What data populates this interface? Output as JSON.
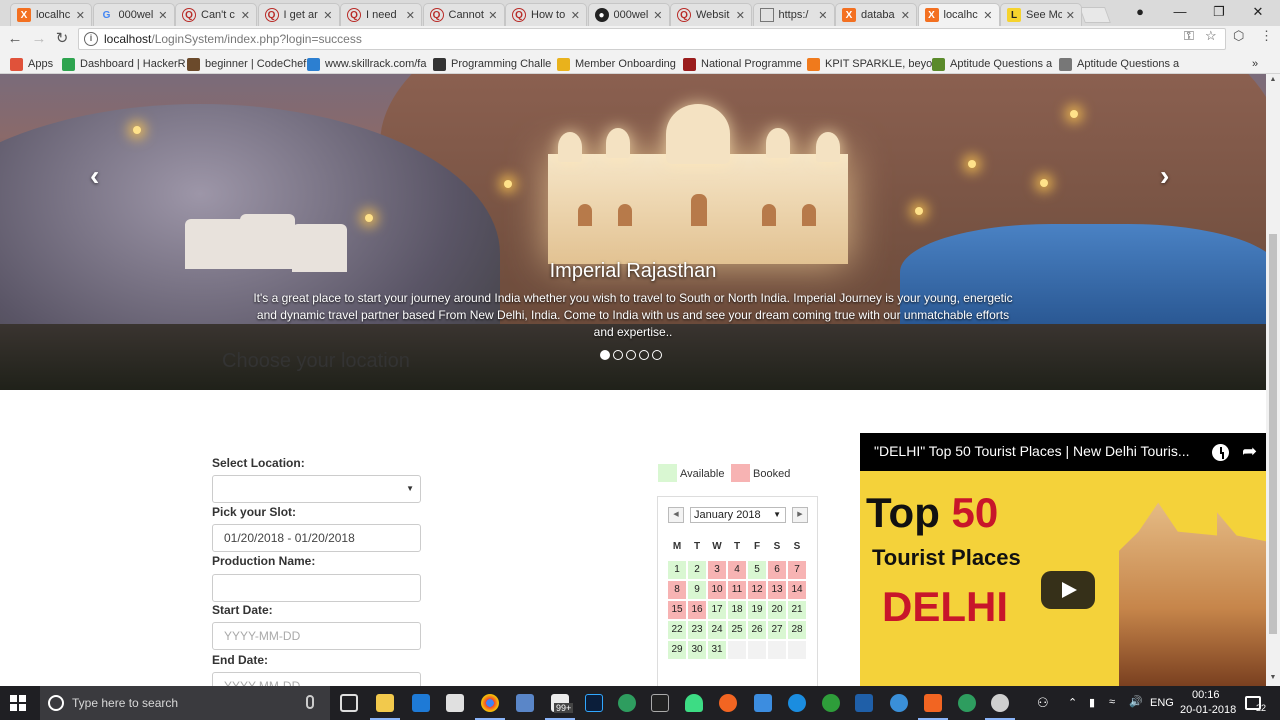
{
  "browser": {
    "tabs": [
      {
        "label": "localhc",
        "fav": "xampp",
        "active": false
      },
      {
        "label": "000wel",
        "fav": "google",
        "active": false
      },
      {
        "label": "Can't c",
        "fav": "quora",
        "active": false
      },
      {
        "label": "I get ar",
        "fav": "quora",
        "active": false
      },
      {
        "label": "I need",
        "fav": "quora",
        "active": false
      },
      {
        "label": "Cannot",
        "fav": "quora",
        "active": false
      },
      {
        "label": "How to",
        "fav": "quora",
        "active": false
      },
      {
        "label": "000wel",
        "fav": "github",
        "active": false
      },
      {
        "label": "Websit",
        "fav": "quora",
        "active": false
      },
      {
        "label": "https:/",
        "fav": "doc",
        "active": false
      },
      {
        "label": "databa",
        "fav": "xampp",
        "active": false
      },
      {
        "label": "localhc",
        "fav": "xampp",
        "active": true
      },
      {
        "label": "See Mc",
        "fav": "coin",
        "active": false
      }
    ],
    "url_host": "localhost",
    "url_path": "/LoginSystem/index.php?login=success",
    "bookmarks": [
      {
        "label": "Apps",
        "color": "#e0523a"
      },
      {
        "label": "Dashboard | HackerR",
        "color": "#2ea44f"
      },
      {
        "label": "beginner | CodeChef",
        "color": "#6b4a2b"
      },
      {
        "label": "www.skillrack.com/fa",
        "color": "#2c7fd1"
      },
      {
        "label": "Programming Challe",
        "color": "#333"
      },
      {
        "label": "Member Onboarding",
        "color": "#e9b21c"
      },
      {
        "label": "National Programme",
        "color": "#9a1c1c"
      },
      {
        "label": "KPIT SPARKLE, beyon",
        "color": "#f07a1c"
      },
      {
        "label": "Aptitude Questions a",
        "color": "#5a8a2a"
      },
      {
        "label": "Aptitude Questions a",
        "color": "#777"
      }
    ]
  },
  "carousel": {
    "title": "Imperial Rajasthan",
    "text": "It's a great place to start your journey around India whether you wish to travel to South or North India. Imperial Journey is your young, energetic and dynamic travel partner based From New Delhi, India. Come to India with us and see your dream coming true with our unmatchable efforts and expertise..",
    "prev_icon": "‹",
    "next_icon": "›",
    "slides": 5,
    "active_slide": 0
  },
  "form": {
    "title": "Choose your location",
    "location_label": "Select Location:",
    "location_value": "",
    "slot_label": "Pick your Slot:",
    "slot_value": "01/20/2018 - 01/20/2018",
    "production_label": "Production Name:",
    "production_value": "",
    "start_label": "Start Date:",
    "start_placeholder": "YYYY-MM-DD",
    "end_label": "End Date:",
    "end_placeholder": "YYYY-MM-DD"
  },
  "legend": {
    "available": "Available",
    "booked": "Booked",
    "available_color": "#d9f7d2",
    "booked_color": "#f7b3b3"
  },
  "calendar": {
    "month": "January 2018",
    "weekdays": [
      "M",
      "T",
      "W",
      "T",
      "F",
      "S",
      "S"
    ],
    "days": [
      {
        "d": "1",
        "s": "avail"
      },
      {
        "d": "2",
        "s": "avail"
      },
      {
        "d": "3",
        "s": "booked"
      },
      {
        "d": "4",
        "s": "booked"
      },
      {
        "d": "5",
        "s": "avail"
      },
      {
        "d": "6",
        "s": "booked"
      },
      {
        "d": "7",
        "s": "booked"
      },
      {
        "d": "8",
        "s": "booked"
      },
      {
        "d": "9",
        "s": "avail"
      },
      {
        "d": "10",
        "s": "booked"
      },
      {
        "d": "11",
        "s": "booked"
      },
      {
        "d": "12",
        "s": "booked"
      },
      {
        "d": "13",
        "s": "booked"
      },
      {
        "d": "14",
        "s": "booked"
      },
      {
        "d": "15",
        "s": "booked"
      },
      {
        "d": "16",
        "s": "booked"
      },
      {
        "d": "17",
        "s": "avail"
      },
      {
        "d": "18",
        "s": "avail"
      },
      {
        "d": "19",
        "s": "avail"
      },
      {
        "d": "20",
        "s": "avail"
      },
      {
        "d": "21",
        "s": "avail"
      },
      {
        "d": "22",
        "s": "avail"
      },
      {
        "d": "23",
        "s": "avail"
      },
      {
        "d": "24",
        "s": "avail"
      },
      {
        "d": "25",
        "s": "avail"
      },
      {
        "d": "26",
        "s": "avail"
      },
      {
        "d": "27",
        "s": "avail"
      },
      {
        "d": "28",
        "s": "avail"
      },
      {
        "d": "29",
        "s": "avail"
      },
      {
        "d": "30",
        "s": "avail"
      },
      {
        "d": "31",
        "s": "avail"
      },
      {
        "d": "",
        "s": "empty"
      },
      {
        "d": "",
        "s": "empty"
      },
      {
        "d": "",
        "s": "empty"
      },
      {
        "d": "",
        "s": "empty"
      }
    ]
  },
  "video": {
    "title": "\"DELHI\" Top 50 Tourist Places | New Delhi Touris...",
    "thumb_line1_a": "Top ",
    "thumb_line1_b": "50",
    "thumb_line2": "Tourist Places",
    "thumb_line3": "DELHI"
  },
  "taskbar": {
    "search_placeholder": "Type here to search",
    "badge": "99+",
    "language": "ENG",
    "time": "00:16",
    "date": "20-01-2018",
    "notifications": "22"
  }
}
